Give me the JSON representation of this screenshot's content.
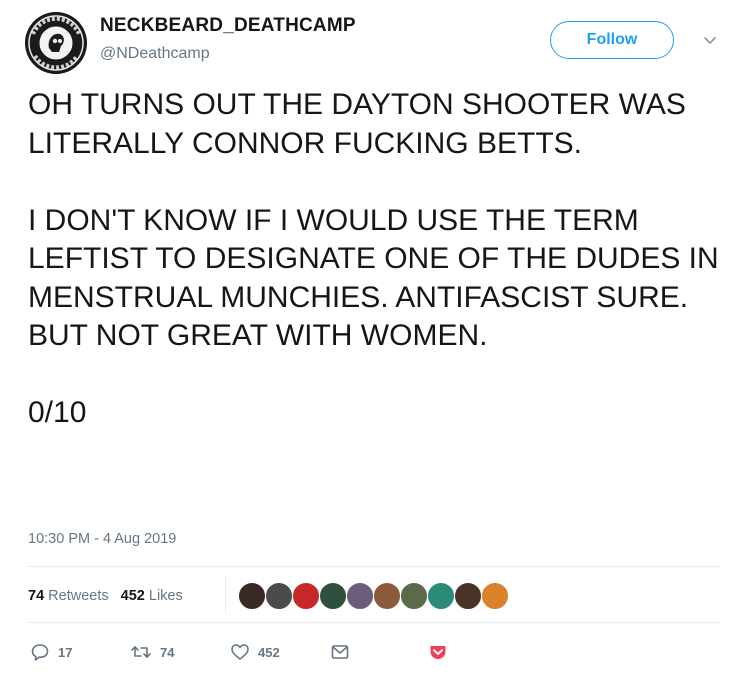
{
  "account": {
    "name": "NECKBEARD_DEATHCAMP",
    "handle": "@NDeathcamp",
    "avatar_icon": "skull-seal-avatar"
  },
  "follow_button": {
    "label": "Follow"
  },
  "tweet": {
    "paragraphs": [
      "OH TURNS OUT THE DAYTON SHOOTER WAS LITERALLY CONNOR FUCKING BETTS.",
      "I DON'T KNOW IF I WOULD USE THE TERM LEFTIST TO DESIGNATE ONE OF THE DUDES IN MENSTRUAL MUNCHIES. ANTIFASCIST SURE. BUT NOT GREAT WITH WOMEN.",
      "0/10"
    ],
    "timestamp": "10:30 PM - 4 Aug 2019"
  },
  "stats": {
    "retweets_count": "74",
    "retweets_label": "Retweets",
    "likes_count": "452",
    "likes_label": "Likes",
    "liker_avatar_count": 10
  },
  "actions": {
    "reply": {
      "icon": "reply-icon",
      "count": "17"
    },
    "retweet": {
      "icon": "retweet-icon",
      "count": "74"
    },
    "like": {
      "icon": "heart-icon",
      "count": "452"
    },
    "dm": {
      "icon": "envelope-icon"
    },
    "pocket": {
      "icon": "pocket-icon"
    }
  },
  "colors": {
    "accent": "#1da1f2",
    "text": "#14171a",
    "muted": "#657786",
    "border": "#e6ecf0",
    "pocket": "#ef4056"
  }
}
